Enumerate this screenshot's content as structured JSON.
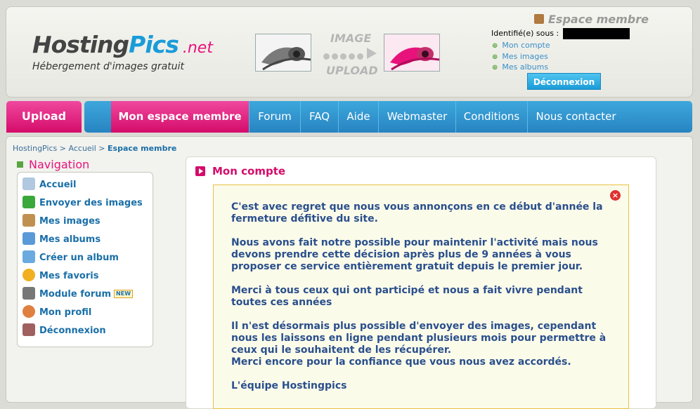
{
  "header": {
    "logo_main_a": "Hosting",
    "logo_main_b": "Pics",
    "logo_net": ".net",
    "tagline": "Hébergement d'images gratuit",
    "upload_line1": "IMAGE",
    "upload_line2": "UPLOAD"
  },
  "member": {
    "title": "Espace membre",
    "identified_label": "Identifié(e) sous :",
    "links": [
      "Mon compte",
      "Mes images",
      "Mes albums"
    ],
    "logout_label": "Déconnexion"
  },
  "nav": {
    "upload": "Upload",
    "items": [
      "Mon espace membre",
      "Forum",
      "FAQ",
      "Aide",
      "Webmaster",
      "Conditions",
      "Nous contacter"
    ]
  },
  "breadcrumb": {
    "a": "HostingPics",
    "sep": " > ",
    "b": "Accueil",
    "c": "Espace membre"
  },
  "sidebar": {
    "title": "Navigation",
    "items": [
      "Accueil",
      "Envoyer des images",
      "Mes images",
      "Mes albums",
      "Créer un album",
      "Mes favoris",
      "Module forum",
      "Mon profil",
      "Déconnexion"
    ],
    "new_badge": "NEW"
  },
  "main": {
    "title": "Mon compte",
    "close_glyph": "×",
    "paragraphs": [
      "C'est avec regret que nous vous annonçons en ce début d'année la fermeture défitive du site.",
      "Nous avons fait notre possible pour maintenir l'activité mais nous devons prendre cette décision après plus de 9 années à vous proposer ce service entièrement gratuit depuis le premier jour.",
      "Merci à tous ceux qui ont participé et nous a fait vivre pendant toutes ces années",
      "Il n'est désormais plus possible d'envoyer des images, cependant nous les laissons en ligne pendant plusieurs mois pour permettre à ceux qui le souhaitent de les récupérer.\nMerci encore pour la confiance que vous nous avez accordés.",
      "L'équipe Hostingpics"
    ]
  },
  "colors": {
    "pink": "#e8127c",
    "blue": "#2784c1",
    "link_blue": "#1a6fa8",
    "notice_text": "#2a4f8c"
  }
}
